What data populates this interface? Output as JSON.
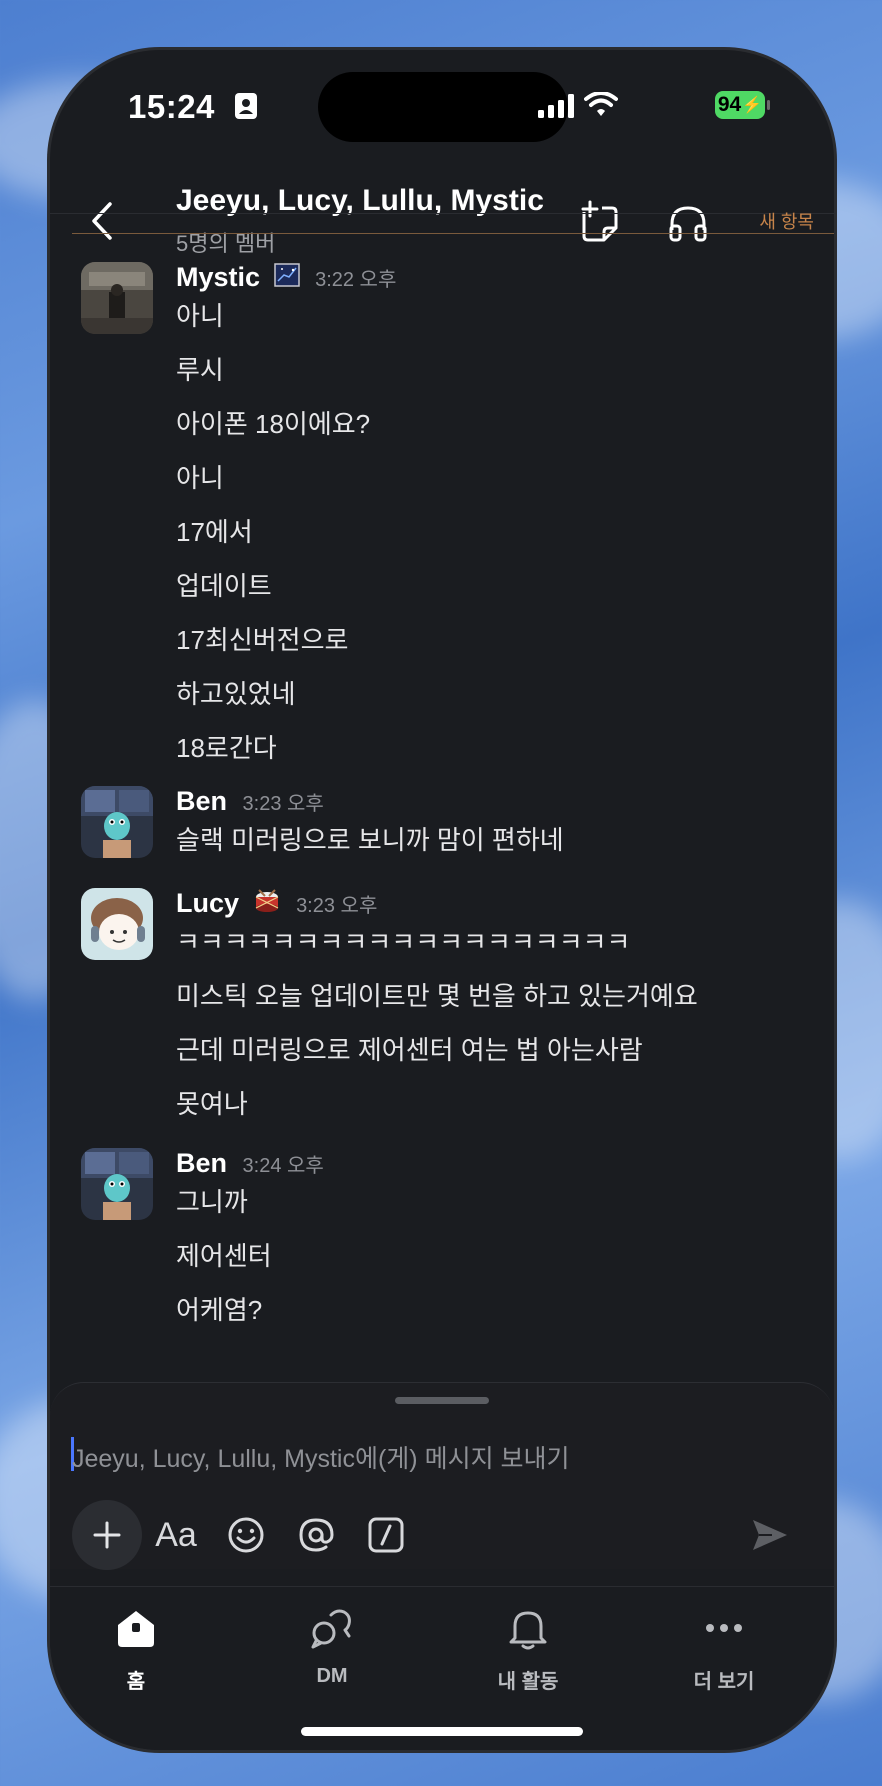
{
  "status_bar": {
    "time": "15:24",
    "battery": "94"
  },
  "header": {
    "title": "Jeeyu, Lucy, Lullu, Mystic",
    "subtitle": "5명의 멤버"
  },
  "new_messages_label": "새 항목",
  "messages": [
    {
      "author": "Mystic",
      "time": "3:22 오후",
      "lines": [
        "아니",
        "루시",
        "아이폰 18이에요?",
        "아니",
        "17에서",
        "업데이트",
        "17최신버전으로",
        "하고있었네",
        "18로간다"
      ]
    },
    {
      "author": "Ben",
      "time": "3:23 오후",
      "lines": [
        "슬랙 미러링으로 보니까 맘이 편하네"
      ]
    },
    {
      "author": "Lucy",
      "time": "3:23 오후",
      "lines": [
        "ㅋㅋㅋㅋㅋㅋㅋㅋㅋㅋㅋㅋㅋㅋㅋㅋㅋㅋㅋ",
        "미스틱 오늘 업데이트만 몇 번을 하고 있는거예요",
        "근데 미러링으로 제어센터 여는 법 아는사람",
        "못여나"
      ]
    },
    {
      "author": "Ben",
      "time": "3:24 오후",
      "lines": [
        "그니까",
        "제어센터",
        "어케염?"
      ]
    }
  ],
  "composer": {
    "placeholder": "Jeeyu, Lucy, Lullu, Mystic에(게) 메시지 보내기"
  },
  "tabbar": {
    "tabs": [
      {
        "label": "홈",
        "icon": "home-icon",
        "active": true
      },
      {
        "label": "DM",
        "icon": "dm-icon",
        "active": false
      },
      {
        "label": "내 활동",
        "icon": "bell-icon",
        "active": false
      },
      {
        "label": "더 보기",
        "icon": "more-icon",
        "active": false
      }
    ]
  },
  "colors": {
    "background": "#1a1c20",
    "accent_blue": "#4a77ff",
    "new_line": "#c7844a",
    "battery": "#4fd964"
  }
}
